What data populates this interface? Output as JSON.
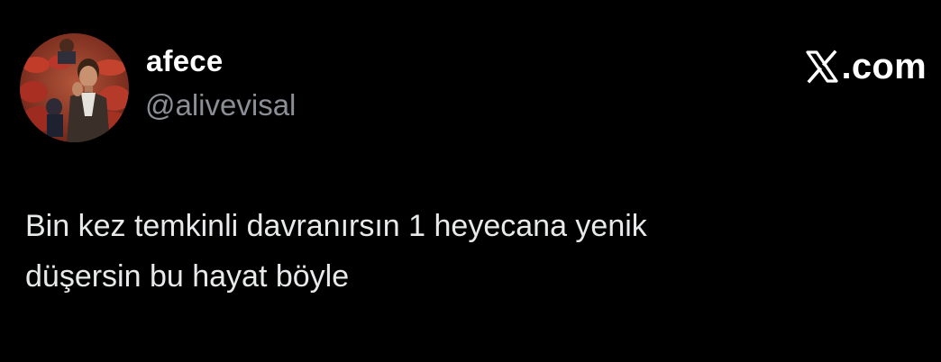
{
  "author": {
    "display_name": "afece",
    "handle": "@alivevisal",
    "avatar_icon": "avatar-photo-icon"
  },
  "brand": {
    "icon": "x-logo-icon",
    "text": ".com"
  },
  "tweet": {
    "lines": [
      "Bin kez temkinli davranırsın 1 heyecana yenik",
      "düşersin bu hayat böyle"
    ]
  },
  "colors": {
    "background": "#000000",
    "name": "#ffffff",
    "handle": "#8b8f95",
    "text": "#e7e9ea"
  }
}
